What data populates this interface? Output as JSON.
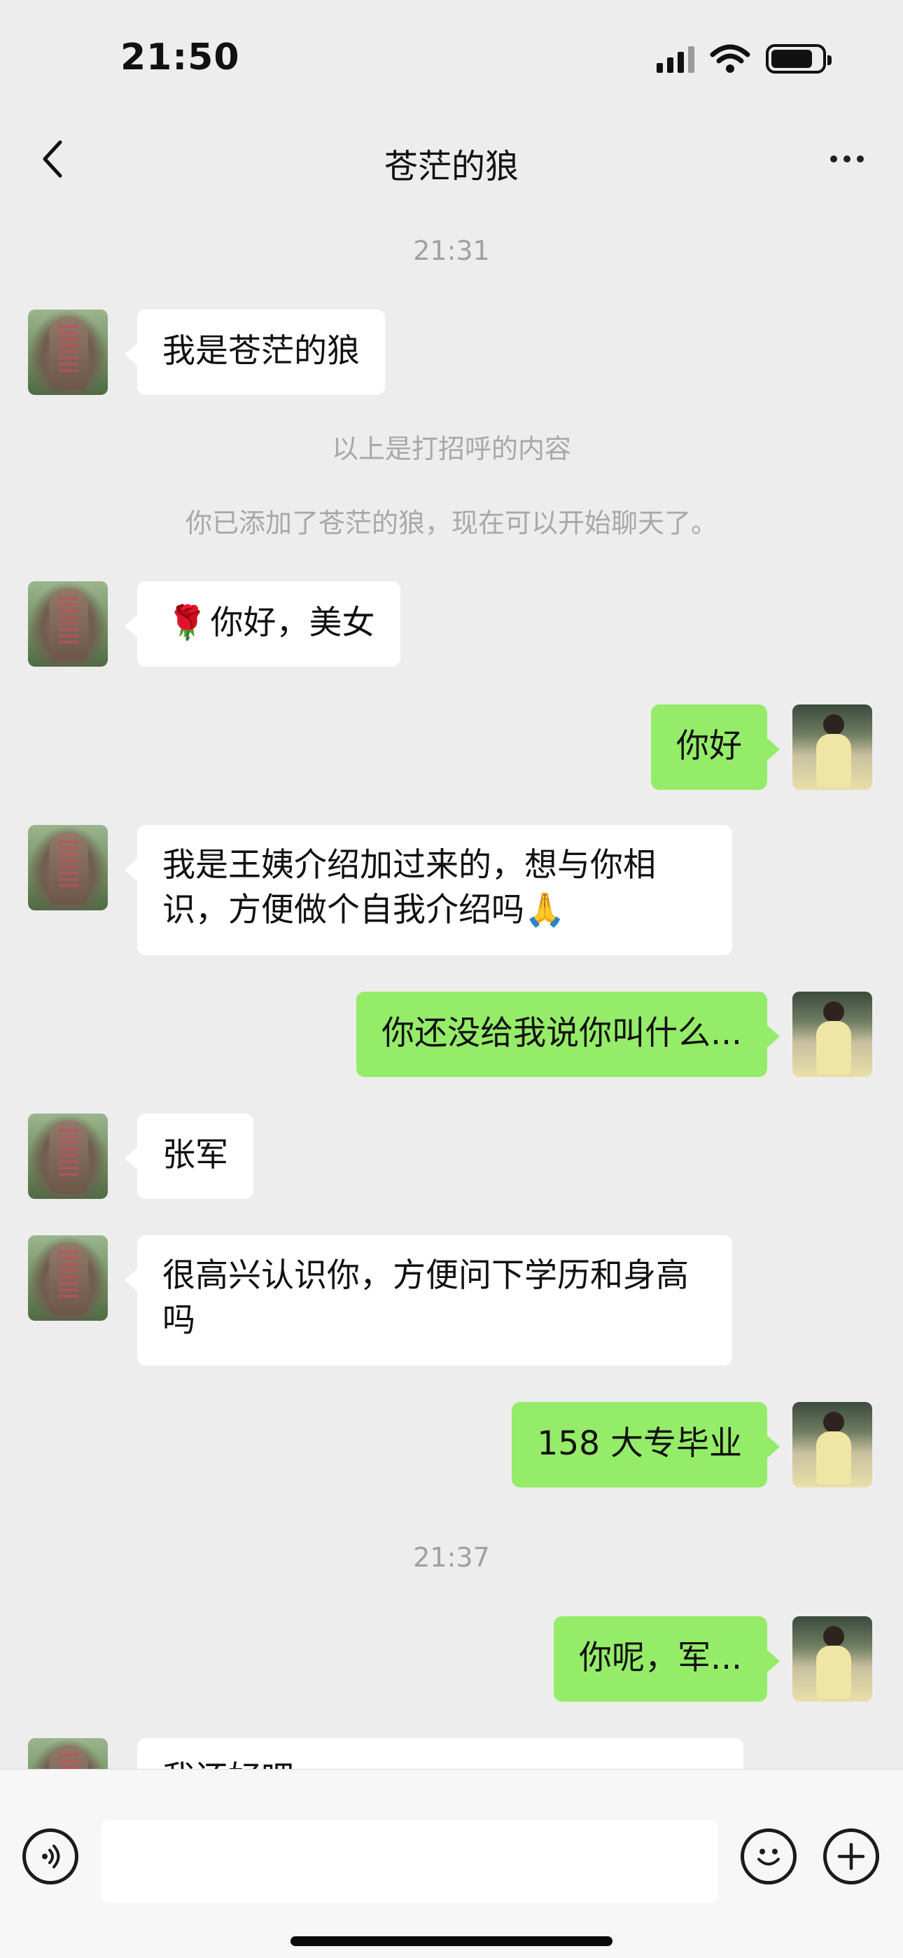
{
  "status_bar": {
    "time": "21:50"
  },
  "header": {
    "title": "苍茫的狼"
  },
  "timestamps": {
    "first": "21:31",
    "second": "21:37"
  },
  "system_notes": {
    "greeting_note": "以上是打招呼的内容",
    "added_note": "你已添加了苍茫的狼，现在可以开始聊天了。"
  },
  "messages": [
    {
      "side": "in",
      "text": "我是苍茫的狼"
    },
    {
      "side": "in",
      "emoji": "🌹",
      "text": "你好，美女"
    },
    {
      "side": "out",
      "text": "你好"
    },
    {
      "side": "in",
      "text": "我是王姨介绍加过来的，想与你相识，方便做个自我介绍吗",
      "trailing_emoji": "🙏"
    },
    {
      "side": "out",
      "text": "你还没给我说你叫什么..."
    },
    {
      "side": "in",
      "text": "张军"
    },
    {
      "side": "in",
      "text": "很高兴认识你，方便问下学历和身高吗"
    },
    {
      "side": "out",
      "text": "158 大专毕业"
    },
    {
      "side": "out",
      "text": "你呢，军..."
    },
    {
      "side": "in",
      "text": "我还好吧，..."
    }
  ],
  "input": {
    "value": "",
    "placeholder": ""
  },
  "icons": {
    "back": "chevron-left-icon",
    "more": "more-icon",
    "voice": "voice-icon",
    "emoji": "emoji-icon",
    "plus": "plus-icon"
  },
  "colors": {
    "background": "#ededed",
    "incoming_bubble": "#ffffff",
    "outgoing_bubble": "#95ec69"
  }
}
